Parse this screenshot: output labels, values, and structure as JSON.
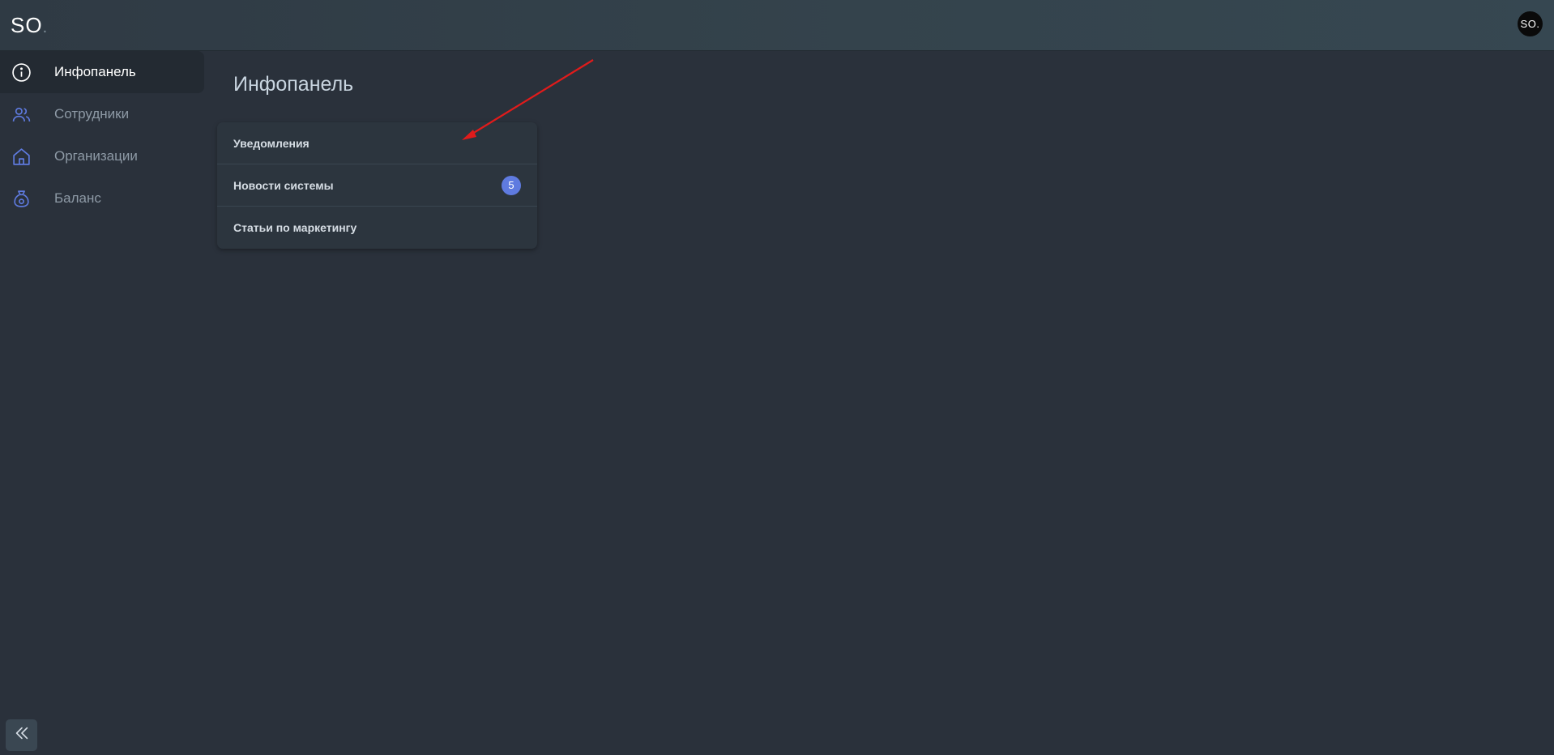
{
  "header": {
    "logo_text": "SO",
    "logo_dot": ".",
    "avatar_text": "SO."
  },
  "sidebar": {
    "items": [
      {
        "label": "Инфопанель",
        "icon": "info-circle-icon",
        "active": true
      },
      {
        "label": "Сотрудники",
        "icon": "users-icon",
        "active": false
      },
      {
        "label": "Организации",
        "icon": "home-icon",
        "active": false
      },
      {
        "label": "Баланс",
        "icon": "money-bag-icon",
        "active": false
      }
    ],
    "collapse_icon": "double-chevron-left-icon"
  },
  "main": {
    "title": "Инфопанель",
    "card": {
      "rows": [
        {
          "label": "Уведомления"
        },
        {
          "label": "Новости системы",
          "badge": "5"
        },
        {
          "label": "Статьи по маркетингу"
        }
      ]
    }
  },
  "colors": {
    "background": "#2a313b",
    "topbar": "#34434c",
    "accent_icon": "#5f7be0",
    "badge": "#5f7be0",
    "annotation_arrow": "#e01b1b"
  }
}
